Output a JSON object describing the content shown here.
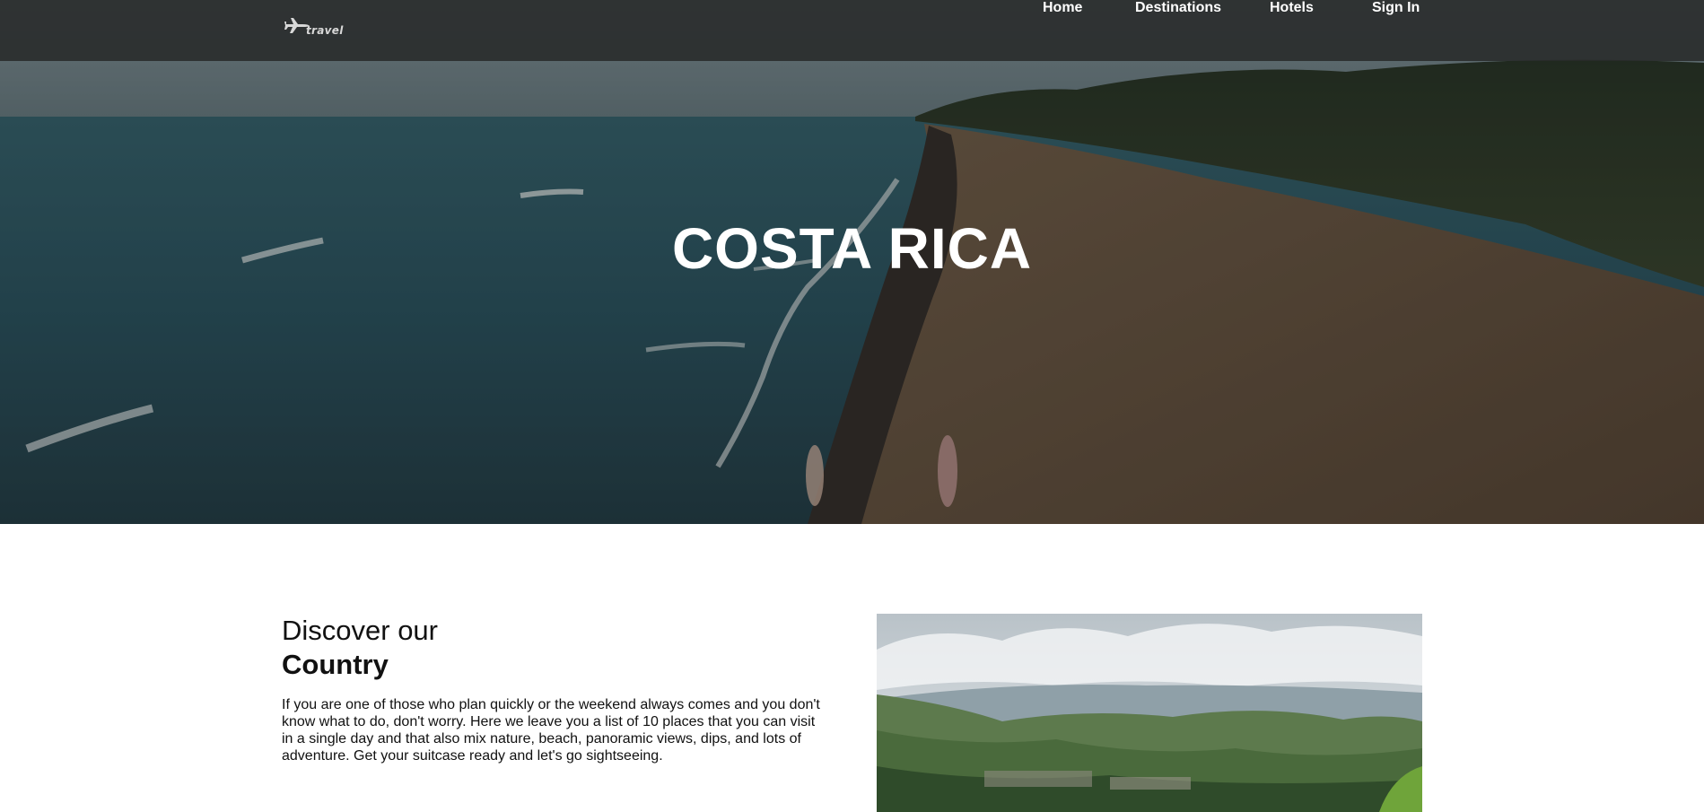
{
  "header": {
    "logo_text": "travel",
    "logo_icon": "airplane-icon",
    "nav": [
      {
        "label": "Home"
      },
      {
        "label": "Destinations"
      },
      {
        "label": "Hotels"
      },
      {
        "label": "Sign In"
      }
    ]
  },
  "hero": {
    "title": "COSTA RICA"
  },
  "discover": {
    "heading_light": "Discover our",
    "heading_bold": "Country",
    "body": "If you are one of those who plan quickly or the weekend always comes and you don't know what to do, don't worry. Here we leave you a list of 10 places that you can visit in a single day and that also mix nature, beach, panoramic views, dips, and lots of adventure. Get your suitcase ready and let's go sightseeing."
  }
}
